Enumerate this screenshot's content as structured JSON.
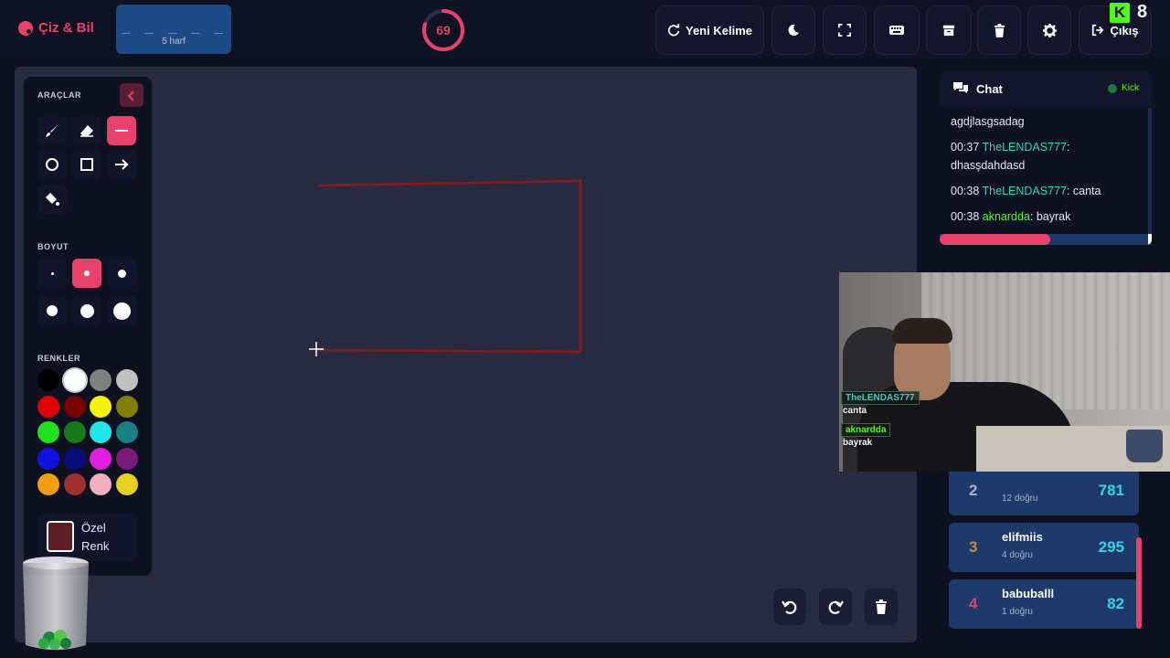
{
  "app": {
    "title": "Çiz & Bil"
  },
  "word": {
    "dashes": "_ _ _ _ _",
    "hint": "5 harf"
  },
  "timer": {
    "value": "69",
    "fraction": 0.8
  },
  "toolbar": {
    "new_word_label": "Yeni Kelime",
    "exit_label": "Çıkış",
    "kick_viewers": "8"
  },
  "tools": {
    "section_tools": "ARAÇLAR",
    "section_size": "BOYUT",
    "section_colors": "RENKLER",
    "custom_color_label_1": "Özel",
    "custom_color_label_2": "Renk",
    "active_tool": "line",
    "active_size": 2,
    "colors": [
      "#000000",
      "#ffffff",
      "#808080",
      "#c0c0c0",
      "#e00000",
      "#7a0000",
      "#f5f500",
      "#808000",
      "#20e020",
      "#1a7a1a",
      "#20e8e8",
      "#1a8080",
      "#1010e0",
      "#0a0a7a",
      "#e020e0",
      "#7a1a7a",
      "#f0a010",
      "#a03030",
      "#f0b0c0",
      "#e8d020"
    ],
    "custom_color": "#5a1f24"
  },
  "chat": {
    "title": "Chat",
    "status": "Kick",
    "messages": [
      {
        "time": "",
        "user": "",
        "text": "agdjlasgsadag"
      },
      {
        "time": "00:37",
        "user": "TheLENDAS777",
        "text": ": dhasşdahdasd"
      },
      {
        "time": "00:38",
        "user": "TheLENDAS777",
        "text": ": canta"
      },
      {
        "time": "00:38",
        "user": "aknardda",
        "text": ": bayrak"
      }
    ],
    "progress": 0.52
  },
  "leaderboard": [
    {
      "rank": "2",
      "name": "",
      "correct": "12 doğru",
      "score": "781",
      "rank_color": "#a8b4cb"
    },
    {
      "rank": "3",
      "name": "elifmiis",
      "correct": "4 doğru",
      "score": "295",
      "rank_color": "#d08a3a"
    },
    {
      "rank": "4",
      "name": "babuballl",
      "correct": "1 doğru",
      "score": "82",
      "rank_color": "#e8416b"
    }
  ],
  "webcam_chat": [
    {
      "user": "TheLENDAS777",
      "text": "canta"
    },
    {
      "user": "aknardda",
      "text": "bayrak"
    }
  ],
  "drawing": {
    "stroke_color": "#8b1a1a"
  }
}
